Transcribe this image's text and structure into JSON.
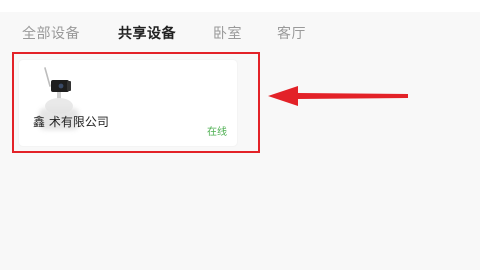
{
  "tabs": [
    {
      "label": "全部设备",
      "active": false
    },
    {
      "label": "共享设备",
      "active": true
    },
    {
      "label": "卧室",
      "active": false
    },
    {
      "label": "客厅",
      "active": false
    }
  ],
  "device": {
    "name": "鑫      术有限公司",
    "status": "在线",
    "icon": "camera-icon"
  },
  "annotation": {
    "box_color": "#e32228",
    "arrow_color": "#e32228"
  },
  "colors": {
    "status": "#4caf50",
    "active_tab": "#222222",
    "inactive_tab": "#9a9a9a"
  }
}
